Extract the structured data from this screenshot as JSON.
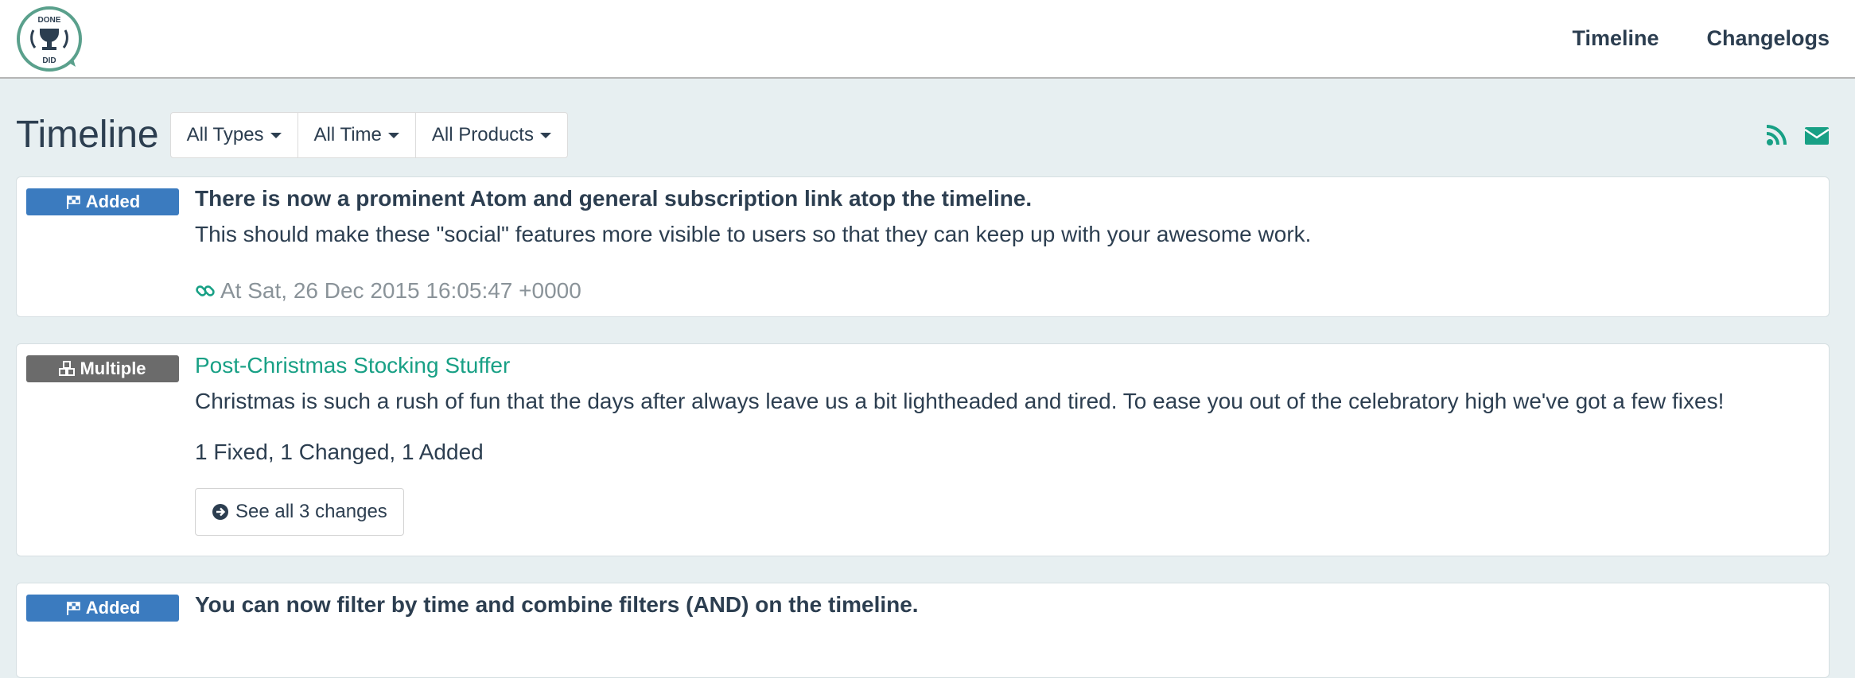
{
  "header": {
    "logo_text_top": "DONE",
    "logo_text_bottom": "DID",
    "nav": [
      {
        "label": "Timeline"
      },
      {
        "label": "Changelogs"
      }
    ]
  },
  "toolbar": {
    "title": "Timeline",
    "filters": [
      {
        "label": "All Types"
      },
      {
        "label": "All Time"
      },
      {
        "label": "All Products"
      }
    ],
    "icons": [
      "rss-icon",
      "envelope-icon"
    ]
  },
  "entries": [
    {
      "badge": "Added",
      "badge_icon": "flag-checkered-icon",
      "title": "There is now a prominent Atom and general subscription link atop the timeline.",
      "description": "This should make these \"social\" features more visible to users so that they can keep up with your awesome work.",
      "timestamp": "At Sat, 26 Dec 2015 16:05:47 +0000"
    },
    {
      "badge": "Multiple",
      "badge_icon": "cubes-icon",
      "title": "Post-Christmas Stocking Stuffer",
      "description": "Christmas is such a rush of fun that the days after always leave us a bit lightheaded and tired. To ease you out of the celebratory high we've got a few fixes!",
      "summary": "1 Fixed, 1 Changed, 1 Added",
      "button": "See all 3 changes"
    },
    {
      "badge": "Added",
      "badge_icon": "flag-checkered-icon",
      "title": "You can now filter by time and combine filters (AND) on the timeline."
    }
  ],
  "colors": {
    "accent": "#18a085",
    "added_badge": "#3b7bbf",
    "multiple_badge": "#6b6b6b",
    "background": "#e7eff1",
    "text": "#2c3e50",
    "muted": "#8a9399"
  }
}
